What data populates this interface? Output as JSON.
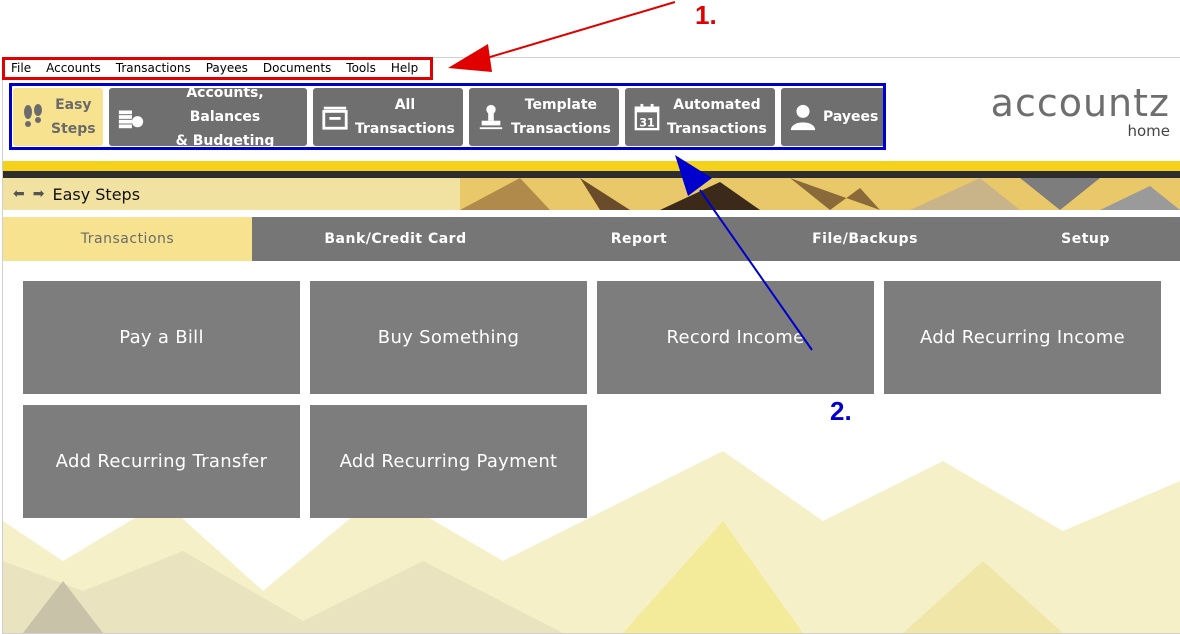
{
  "menu": [
    "File",
    "Accounts",
    "Transactions",
    "Payees",
    "Documents",
    "Tools",
    "Help"
  ],
  "toolbar": {
    "buttons": [
      {
        "label": "Easy\nSteps",
        "icon": "footsteps-icon",
        "active": true
      },
      {
        "label": "Accounts, Balances\n& Budgeting",
        "icon": "coins-icon",
        "active": false
      },
      {
        "label": "All\nTransactions",
        "icon": "inbox-tray-icon",
        "active": false
      },
      {
        "label": "Template\nTransactions",
        "icon": "stamp-icon",
        "active": false
      },
      {
        "label": "Automated\nTransactions",
        "icon": "calendar-31-icon",
        "active": false
      },
      {
        "label": "Payees",
        "icon": "person-icon",
        "active": false
      }
    ]
  },
  "logo": {
    "word": "accountz",
    "sub": "home"
  },
  "breadcrumb": {
    "title": "Easy Steps"
  },
  "tabs": [
    {
      "label": "Transactions",
      "active": true
    },
    {
      "label": "Bank/Credit Card",
      "active": false
    },
    {
      "label": "Report",
      "active": false
    },
    {
      "label": "File/Backups",
      "active": false
    },
    {
      "label": "Setup",
      "active": false
    }
  ],
  "tiles": [
    "Pay a Bill",
    "Buy Something",
    "Record Income",
    "Add Recurring Income",
    "Add Recurring Transfer",
    "Add Recurring Payment"
  ],
  "annotations": {
    "label1": "1.",
    "label2": "2.",
    "color1": "#e00000",
    "color2": "#0000cc"
  },
  "colors": {
    "accent_yellow": "#f4d21a",
    "tab_active": "#f7e38f",
    "button_gray": "#6f6f6f"
  }
}
